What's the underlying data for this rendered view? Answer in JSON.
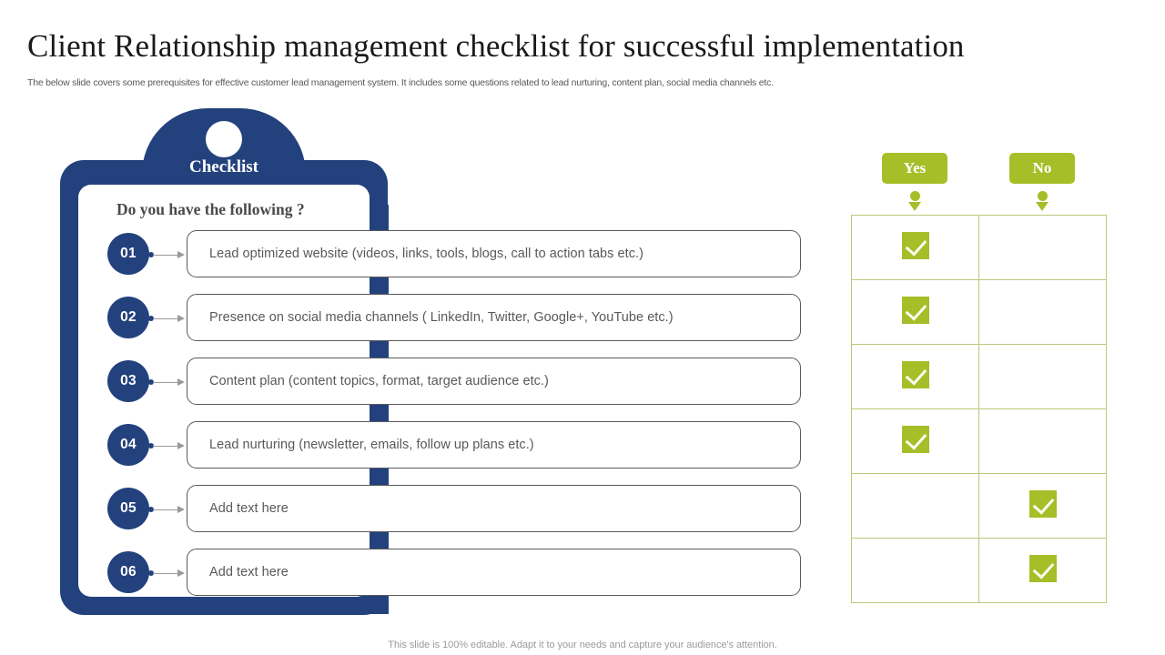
{
  "slide": {
    "title": "Client Relationship management checklist for successful implementation",
    "subtitle": "The below slide covers some prerequisites for effective customer lead management system. It includes some questions related to lead nurturing, content plan, social media channels etc.",
    "footer": "This slide is 100% editable. Adapt it to your needs and capture your audience's attention."
  },
  "clipboard": {
    "tab_label": "Checklist",
    "question": "Do you have the following ?",
    "navy": "#23417D"
  },
  "answers": {
    "yes_label": "Yes",
    "no_label": "No",
    "green": "#A6BE28",
    "border": "#BCC978"
  },
  "checklist": {
    "items": [
      {
        "number": "01",
        "text": "Lead optimized website (videos, links, tools, blogs, call to action tabs etc.)",
        "yes": true,
        "no": false
      },
      {
        "number": "02",
        "text": "Presence on social media channels ( LinkedIn, Twitter, Google+, YouTube  etc.)",
        "yes": true,
        "no": false
      },
      {
        "number": "03",
        "text": "Content plan (content topics, format, target audience etc.)",
        "yes": true,
        "no": false
      },
      {
        "number": "04",
        "text": "Lead nurturing (newsletter, emails, follow up plans etc.)",
        "yes": true,
        "no": false
      },
      {
        "number": "05",
        "text": "Add text here",
        "yes": false,
        "no": true
      },
      {
        "number": "06",
        "text": "Add text here",
        "yes": false,
        "no": true
      }
    ]
  }
}
